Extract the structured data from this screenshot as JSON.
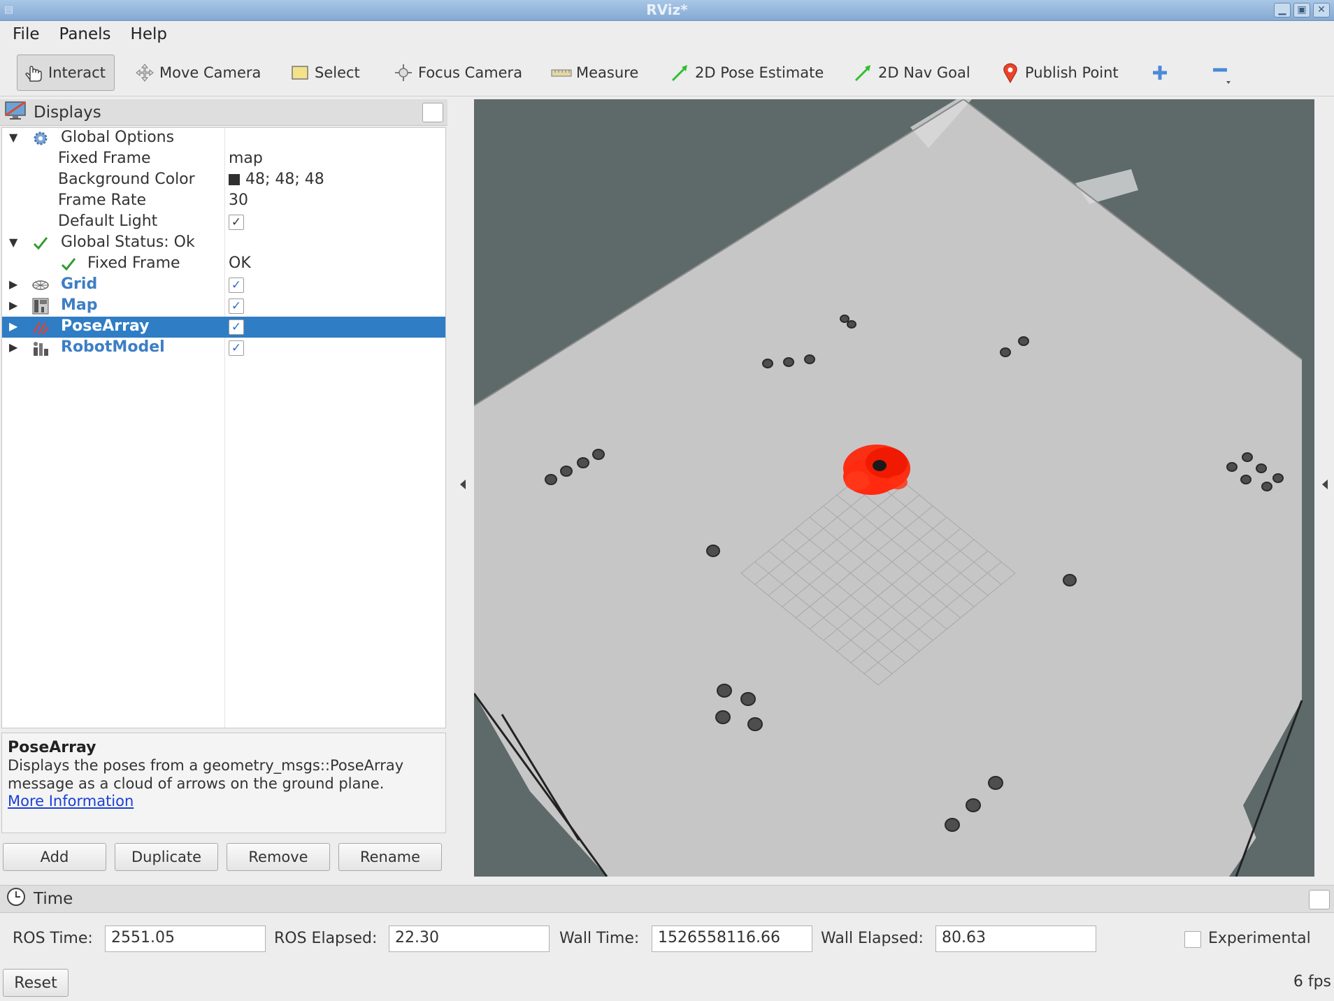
{
  "window": {
    "title": "RViz*",
    "app_icon": "rviz-logo-icon"
  },
  "menu": [
    "File",
    "Panels",
    "Help"
  ],
  "toolbar": {
    "tools": [
      {
        "label": "Interact",
        "icon": "hand-icon",
        "active": true
      },
      {
        "label": "Move Camera",
        "icon": "move-arrows-icon"
      },
      {
        "label": "Select",
        "icon": "select-box-icon"
      },
      {
        "label": "Focus Camera",
        "icon": "focus-target-icon"
      },
      {
        "label": "Measure",
        "icon": "ruler-icon"
      },
      {
        "label": "2D Pose Estimate",
        "icon": "green-arrow-icon"
      },
      {
        "label": "2D Nav Goal",
        "icon": "green-arrow-icon"
      },
      {
        "label": "Publish Point",
        "icon": "map-pin-icon"
      }
    ],
    "add_tool_icon": "plus-icon",
    "remove_tool_icon": "minus-icon"
  },
  "displays": {
    "title": "Displays",
    "rows": [
      {
        "label": "Global Options",
        "expanded": true
      },
      {
        "label": "Fixed Frame",
        "value": "map"
      },
      {
        "label": "Background Color",
        "value": "48; 48; 48",
        "color": "#303030"
      },
      {
        "label": "Frame Rate",
        "value": "30"
      },
      {
        "label": "Default Light",
        "checked": true
      },
      {
        "label": "Global Status: Ok",
        "expanded": true
      },
      {
        "label": "Fixed Frame",
        "value": "OK"
      },
      {
        "label": "Grid",
        "checked": true
      },
      {
        "label": "Map",
        "checked": true
      },
      {
        "label": "PoseArray",
        "checked": true,
        "selected": true
      },
      {
        "label": "RobotModel",
        "checked": true
      }
    ],
    "description": {
      "title": "PoseArray",
      "line1": "Displays the poses from a geometry_msgs::PoseArray",
      "line2": "message as a cloud of arrows on the ground plane.",
      "link": "More Information"
    },
    "buttons": [
      "Add",
      "Duplicate",
      "Remove",
      "Rename"
    ]
  },
  "time": {
    "title": "Time",
    "ros_time_label": "ROS Time:",
    "ros_time": "2551.05",
    "ros_elapsed_label": "ROS Elapsed:",
    "ros_elapsed": "22.30",
    "wall_time_label": "Wall Time:",
    "wall_time": "1526558116.66",
    "wall_elapsed_label": "Wall Elapsed:",
    "wall_elapsed": "80.63",
    "experimental_label": "Experimental",
    "experimental_checked": false,
    "reset_label": "Reset",
    "fps": "6 fps"
  },
  "colors": {
    "selection": "#2f7dc5",
    "plugin_text": "#3d7ec4",
    "map_free": "#c6c6c6",
    "map_unknown": "#5d6a69",
    "particles": "#ff1e00"
  }
}
